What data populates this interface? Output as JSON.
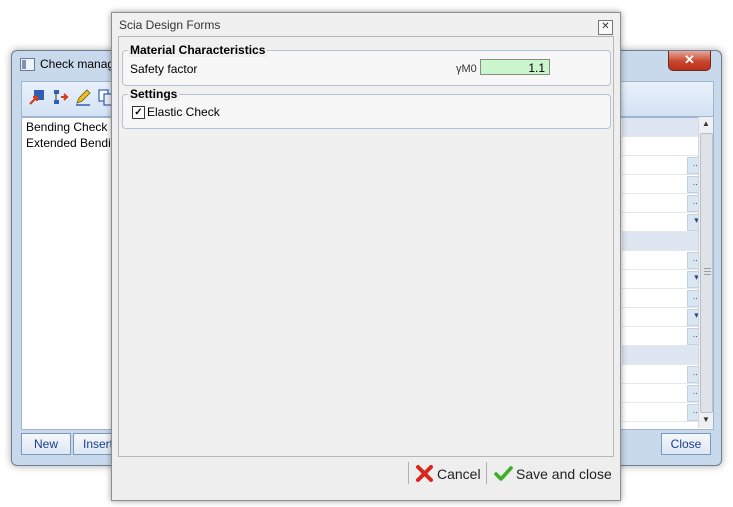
{
  "background_window": {
    "title": "Check manag",
    "list_items": [
      "Bending Check",
      "Extended Bendin"
    ],
    "buttons": {
      "new": "New",
      "insert": "Insert",
      "close": "Close"
    },
    "grid_btn_glyph": "...",
    "dropdown_glyph": "▾",
    "close_glyph": "✕"
  },
  "dialog": {
    "title": "Scia Design Forms",
    "close_glyph": "✕",
    "material": {
      "legend": "Material Characteristics",
      "safety_factor_label": "Safety factor",
      "symbol": "γM0",
      "safety_factor_value": "1.1"
    },
    "settings": {
      "legend": "Settings",
      "elastic_check_label": "Elastic Check",
      "elastic_check_checked": true,
      "check_glyph": "✓"
    },
    "footer": {
      "cancel_label": "Cancel",
      "save_label": "Save and close"
    }
  },
  "colors": {
    "input_bg": "#ccf7cc",
    "cancel_icon": "#d9261c",
    "save_icon": "#3fae2a"
  }
}
